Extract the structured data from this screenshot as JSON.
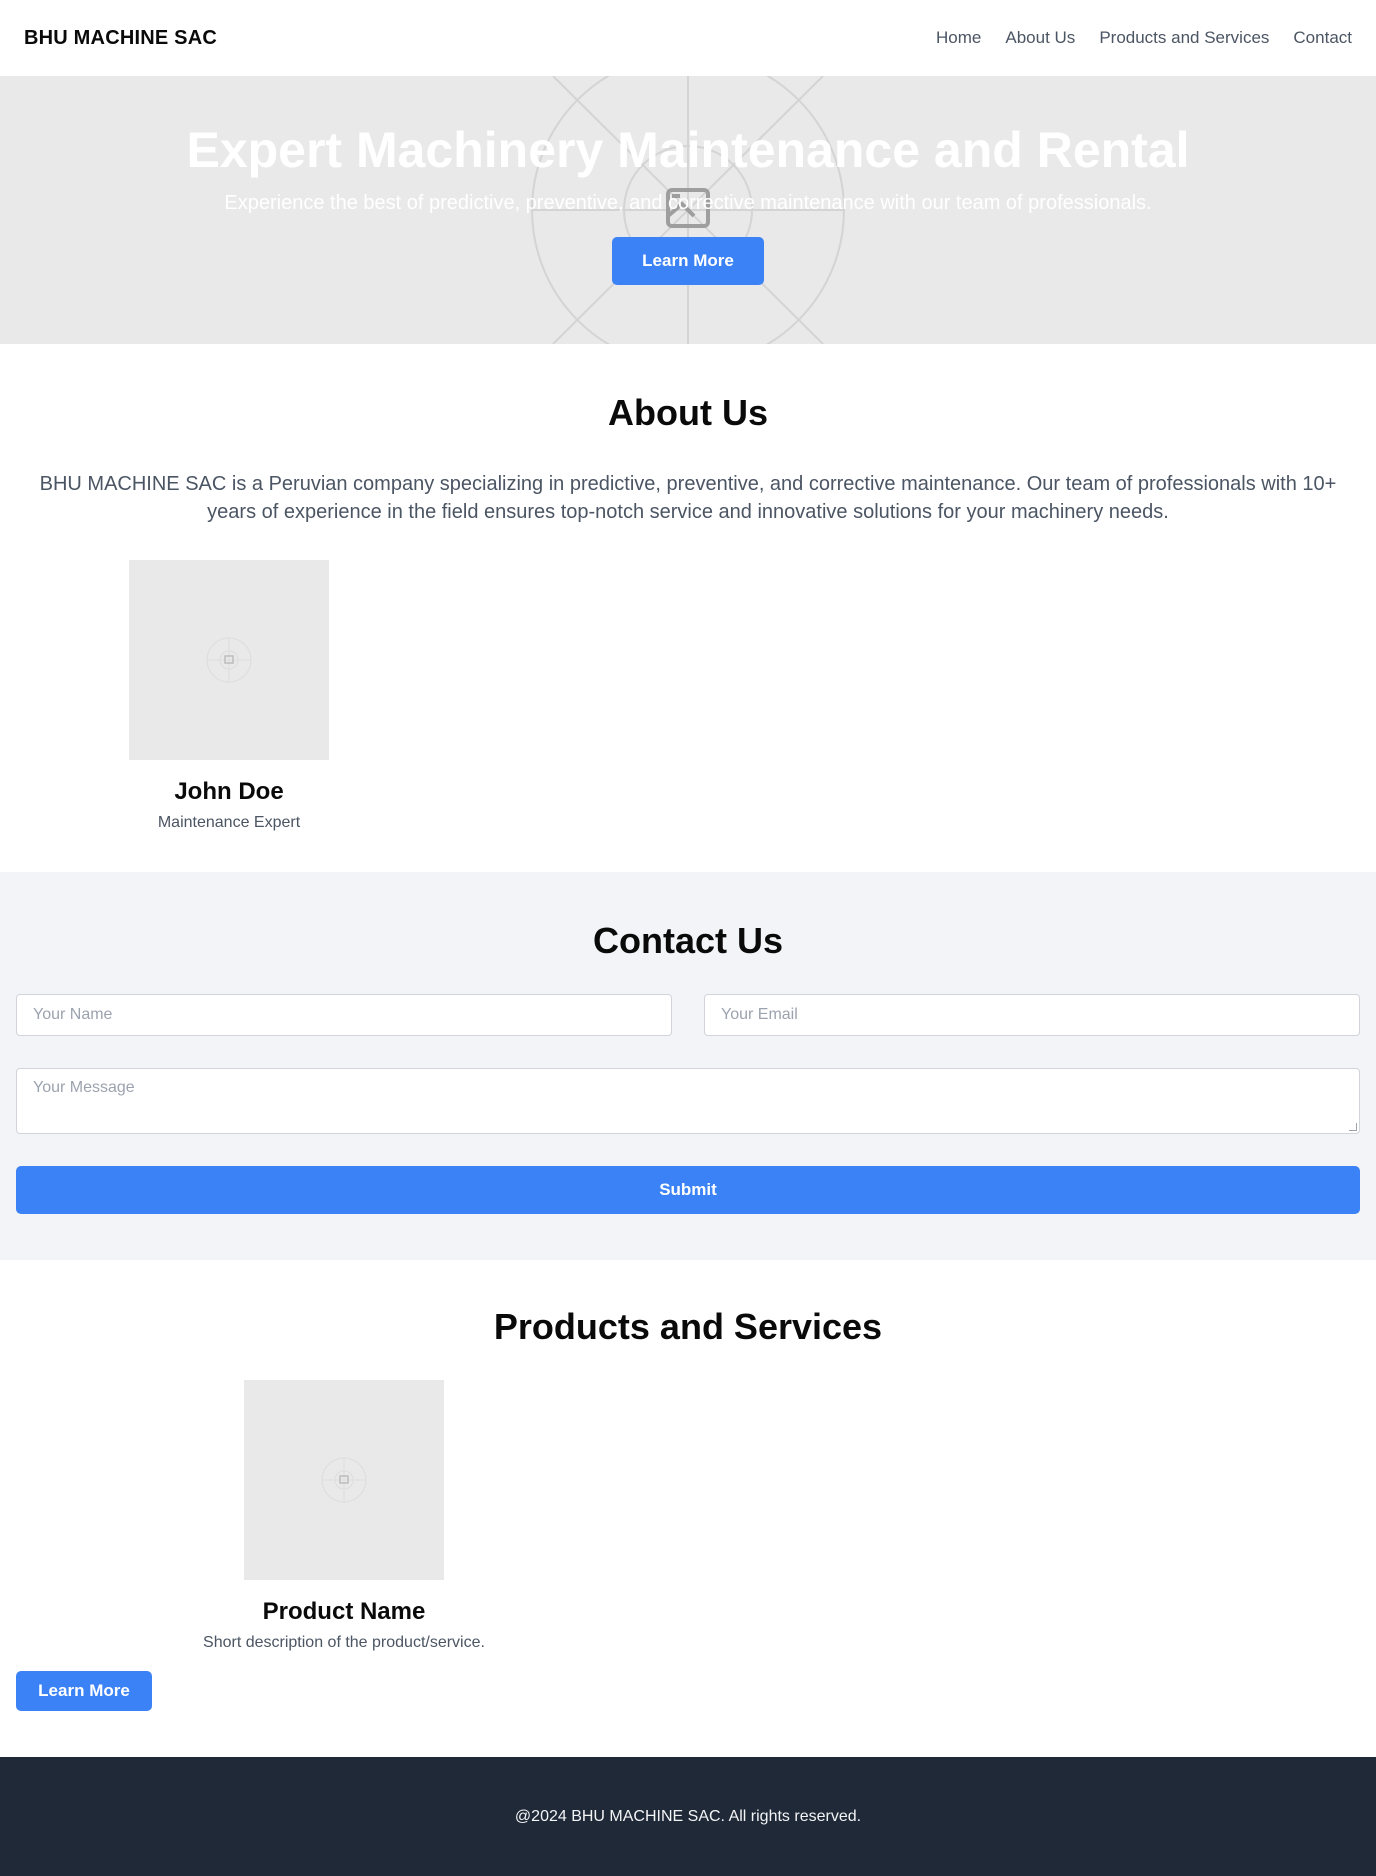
{
  "header": {
    "brand": "BHU MACHINE SAC",
    "nav": [
      "Home",
      "About Us",
      "Products and Services",
      "Contact"
    ]
  },
  "hero": {
    "title": "Expert Machinery Maintenance and Rental",
    "subtitle": "Experience the best of predictive, preventive, and corrective maintenance with our team of professionals.",
    "button": "Learn More",
    "image_icon": "image-placeholder-icon"
  },
  "about": {
    "title": "About Us",
    "text": "BHU MACHINE SAC is a Peruvian company specializing in predictive, preventive, and corrective maintenance. Our team of professionals with 10+ years of experience in the field ensures top-notch service and innovative solutions for your machinery needs.",
    "team": [
      {
        "name": "John Doe",
        "role": "Maintenance Expert"
      }
    ]
  },
  "contact": {
    "title": "Contact Us",
    "name_placeholder": "Your Name",
    "email_placeholder": "Your Email",
    "message_placeholder": "Your Message",
    "submit": "Submit"
  },
  "products": {
    "title": "Products and Services",
    "items": [
      {
        "name": "Product Name",
        "description": "Short description of the product/service.",
        "button": "Learn More"
      }
    ]
  },
  "footer": {
    "text": "@2024 BHU MACHINE SAC. All rights reserved."
  },
  "colors": {
    "accent": "#3b82f6",
    "footer_bg": "#1f2937",
    "contact_bg": "#f2f4f7",
    "placeholder_bg": "#e9e9e9"
  }
}
